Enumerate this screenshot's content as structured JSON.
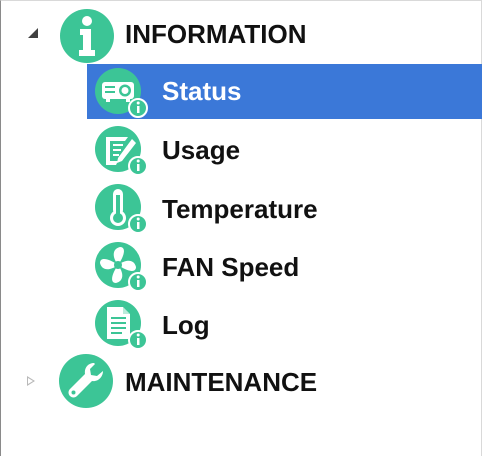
{
  "tree": {
    "groups": [
      {
        "label": "INFORMATION",
        "expanded": true,
        "icon": "info-icon"
      },
      {
        "label": "MAINTENANCE",
        "expanded": false,
        "icon": "wrench-icon"
      }
    ],
    "items": [
      {
        "label": "Status",
        "icon": "projector-icon",
        "selected": true
      },
      {
        "label": "Usage",
        "icon": "usage-icon"
      },
      {
        "label": "Temperature",
        "icon": "thermometer-icon"
      },
      {
        "label": "FAN Speed",
        "icon": "fan-icon"
      },
      {
        "label": "Log",
        "icon": "document-icon"
      }
    ]
  },
  "colors": {
    "icon_green": "#3cc596",
    "selection_blue": "#3b78d8",
    "text": "#111111"
  }
}
